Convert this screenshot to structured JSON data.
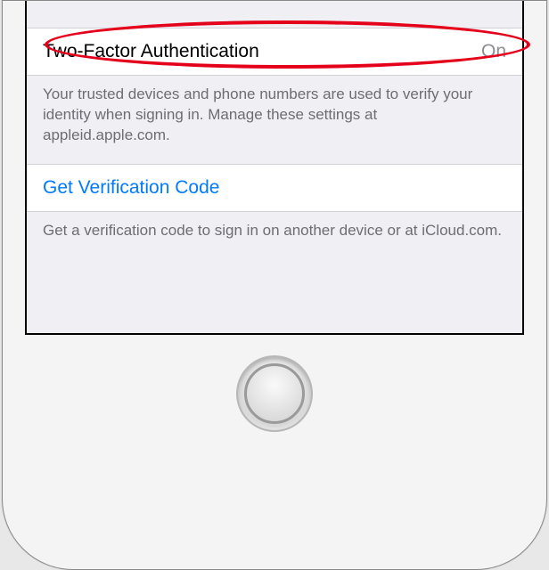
{
  "section1": {
    "row": {
      "label": "Two-Factor Authentication",
      "value": "On"
    },
    "footer": "Your trusted devices and phone numbers are used to verify your identity when signing in. Manage these settings at appleid.apple.com."
  },
  "section2": {
    "row": {
      "label": "Get Verification Code"
    },
    "footer": "Get a verification code to sign in on another device or at iCloud.com."
  }
}
